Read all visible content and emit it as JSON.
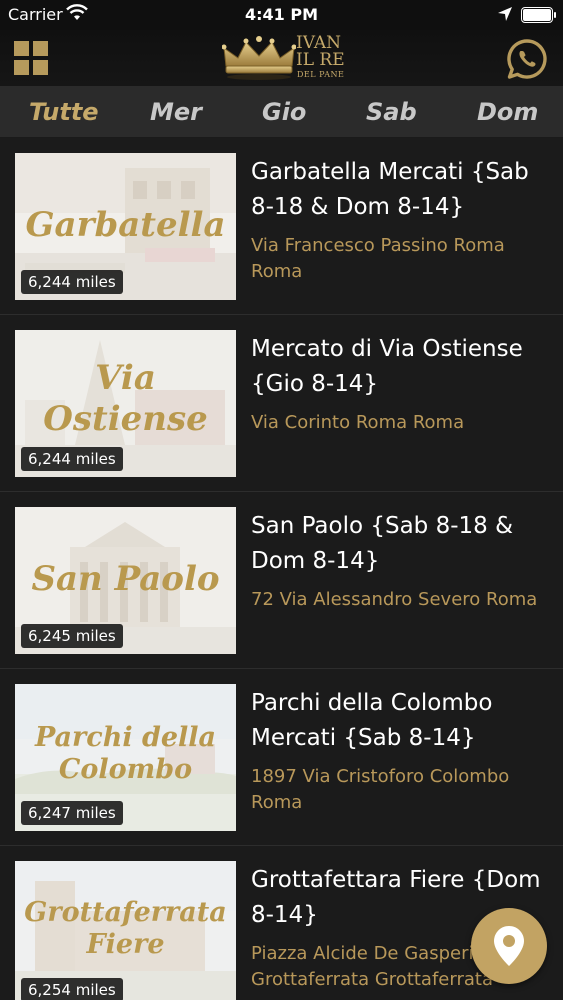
{
  "status_bar": {
    "carrier": "Carrier",
    "time": "4:41 PM"
  },
  "header": {
    "logo": {
      "line1": "IVAN",
      "line2": "IL RE",
      "line3": "DEL PANE"
    }
  },
  "tabs": [
    {
      "label": "Tutte",
      "active": true
    },
    {
      "label": "Mer",
      "active": false
    },
    {
      "label": "Gio",
      "active": false
    },
    {
      "label": "Sab",
      "active": false
    },
    {
      "label": "Dom",
      "active": false
    }
  ],
  "markets": [
    {
      "thumb_text": "Garbatella",
      "distance": "6,244 miles",
      "title": "Garbatella Mercati {Sab 8-18 & Dom 8-14}",
      "address": "Via Francesco Passino Roma Roma"
    },
    {
      "thumb_text": "Via Ostiense",
      "distance": "6,244 miles",
      "title": "Mercato di Via Ostiense {Gio 8-14}",
      "address": "Via Corinto Roma Roma"
    },
    {
      "thumb_text": "San Paolo",
      "distance": "6,245 miles",
      "title": "San Paolo {Sab 8-18 & Dom 8-14}",
      "address": "72 Via Alessandro Severo Roma"
    },
    {
      "thumb_text": "Parchi della Colombo",
      "distance": "6,247 miles",
      "title": "Parchi della Colombo Mercati {Sab 8-14}",
      "address": "1897 Via Cristoforo Colombo Roma"
    },
    {
      "thumb_text": "Grottaferrata Fiere",
      "distance": "6,254 miles",
      "title": "Grottafettara Fiere {Dom 8-14}",
      "address": "Piazza Alcide De Gasperi Grottaferrata Grottaferrata"
    }
  ],
  "icons": {
    "menu": "grid-menu-icon",
    "whatsapp": "whatsapp-icon",
    "map": "map-pin-icon"
  },
  "colors": {
    "accent": "#c5a96a",
    "background": "#1b1b1b",
    "tabbar": "#2b2b2b"
  }
}
